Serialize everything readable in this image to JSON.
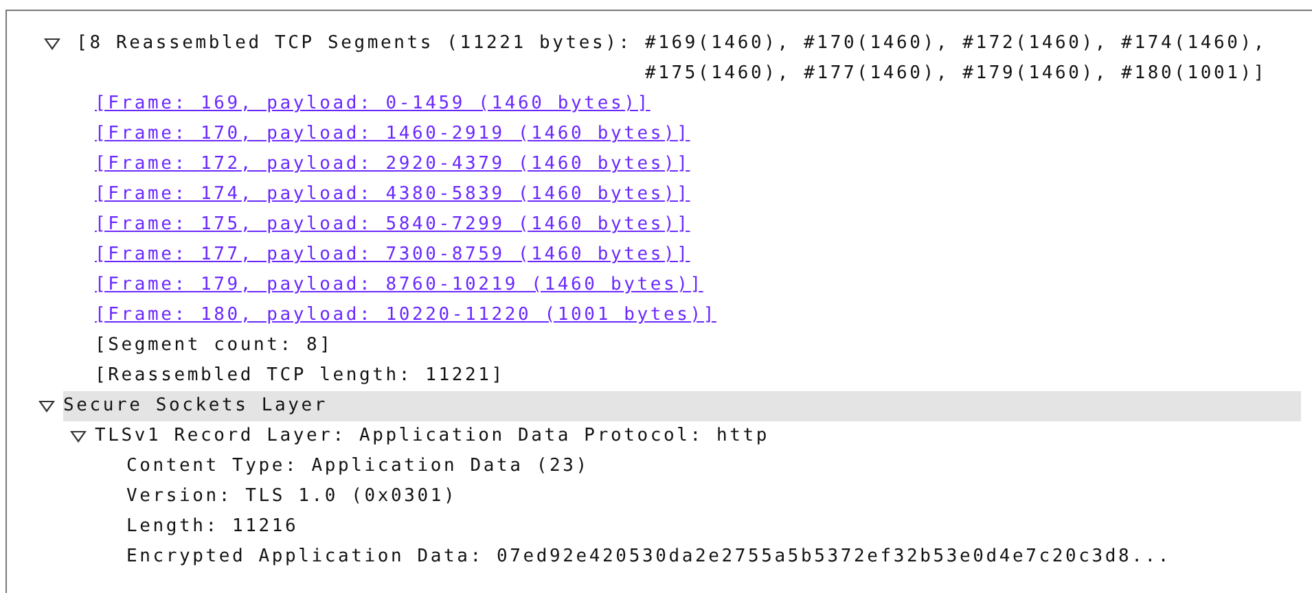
{
  "tree": [
    {
      "label": "[8 Reassembled TCP Segments (11221 bytes): #169(1460), #170(1460), #172(1460), #174(1460), #175(1460), #177(1460), #179(1460), #180(1001)]",
      "expanded": true,
      "selected": false,
      "children": [
        {
          "label": "[Frame: 169, payload: 0-1459 (1460 bytes)]",
          "kind": "link",
          "selected": false
        },
        {
          "label": "[Frame: 170, payload: 1460-2919 (1460 bytes)]",
          "kind": "link",
          "selected": false
        },
        {
          "label": "[Frame: 172, payload: 2920-4379 (1460 bytes)]",
          "kind": "link",
          "selected": false
        },
        {
          "label": "[Frame: 174, payload: 4380-5839 (1460 bytes)]",
          "kind": "link",
          "selected": false
        },
        {
          "label": "[Frame: 175, payload: 5840-7299 (1460 bytes)]",
          "kind": "link",
          "selected": false
        },
        {
          "label": "[Frame: 177, payload: 7300-8759 (1460 bytes)]",
          "kind": "link",
          "selected": false
        },
        {
          "label": "[Frame: 179, payload: 8760-10219 (1460 bytes)]",
          "kind": "link",
          "selected": false
        },
        {
          "label": "[Frame: 180, payload: 10220-11220 (1001 bytes)]",
          "kind": "link",
          "selected": false
        },
        {
          "label": "[Segment count: 8]",
          "selected": false
        },
        {
          "label": "[Reassembled TCP length: 11221]",
          "selected": false
        }
      ]
    },
    {
      "label": "Secure Sockets Layer",
      "expanded": true,
      "selected": true,
      "children": [
        {
          "label": "TLSv1 Record Layer: Application Data Protocol: http",
          "expanded": true,
          "selected": false,
          "children": [
            {
              "label": "Content Type: Application Data (23)",
              "selected": false
            },
            {
              "label": "Version: TLS 1.0 (0x0301)",
              "selected": false
            },
            {
              "label": "Length: 11216",
              "selected": false
            },
            {
              "label": "Encrypted Application Data: 07ed92e420530da2e2755a5b5372ef32b53e0d4e7c20c3d8...",
              "selected": false
            }
          ]
        }
      ]
    }
  ]
}
